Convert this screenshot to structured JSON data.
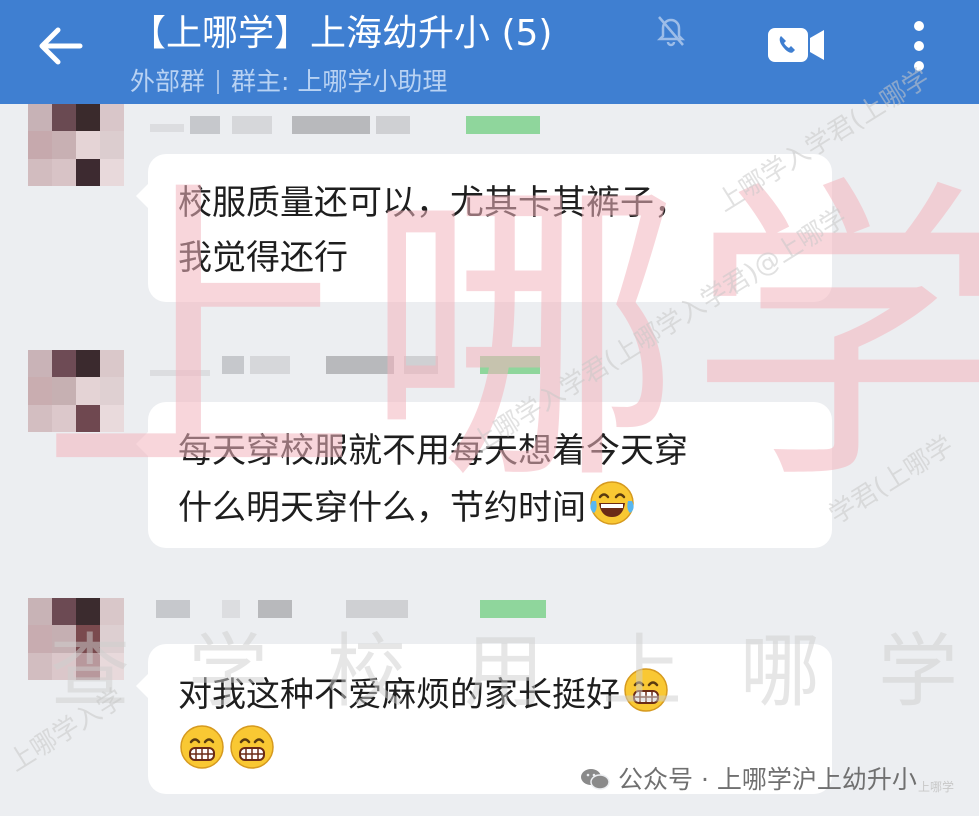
{
  "header": {
    "title": "【上哪学】上海幼升小 (5)",
    "subtitle_group_type": "外部群",
    "subtitle_owner": "群主: 上哪学小助理"
  },
  "messages": [
    {
      "lines": [
        "校服质量还可以，尤其卡其裤子，",
        "我觉得还行"
      ]
    },
    {
      "lines": [
        "每天穿校服就不用每天想着今天穿",
        "什么明天穿什么，节约时间"
      ],
      "emoji": "laughing-tears"
    },
    {
      "lines": [
        "对我这种不爱麻烦的家长挺好"
      ],
      "emoji": "grinning",
      "emoji_line": "grinning-grinning"
    }
  ],
  "watermark": {
    "big": "上哪学",
    "row": "查学校用上哪学",
    "diag_1": "上哪学入学君(上哪学入学君)@上哪学",
    "diag_2": "上哪学入学君(上哪学",
    "diag_3": "上哪学入学",
    "diag_4": "学君(上哪学"
  },
  "footer": {
    "source": "公众号 · 上哪学沪上幼升小",
    "corner": "上哪学"
  },
  "colors": {
    "header_bg": "#3f7fd1",
    "chat_bg": "#eceef1",
    "bubble_bg": "#ffffff",
    "watermark_red": "#f4b5be"
  }
}
